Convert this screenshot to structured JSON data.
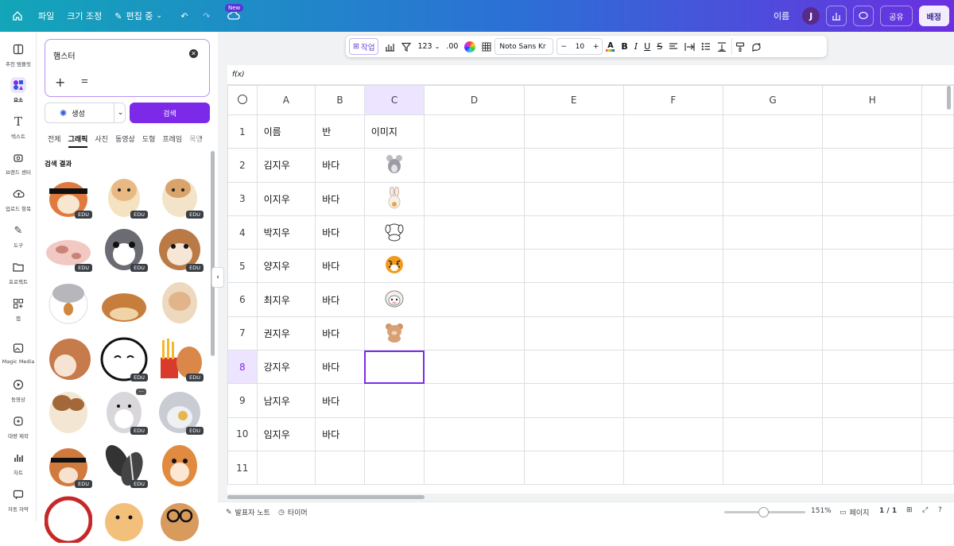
{
  "topbar": {
    "file": "파일",
    "resize": "크기 조정",
    "editing": "편집 중",
    "new_badge": "New",
    "name": "이름",
    "avatar": "J",
    "share": "공유",
    "deploy": "배정"
  },
  "leftnav": {
    "items": [
      {
        "label": "추천 템플릿",
        "icon": "template-icon"
      },
      {
        "label": "요소",
        "icon": "elements-icon"
      },
      {
        "label": "텍스트",
        "icon": "text-icon"
      },
      {
        "label": "브랜드 센터",
        "icon": "brand-icon"
      },
      {
        "label": "업로드 항목",
        "icon": "upload-icon"
      },
      {
        "label": "도구",
        "icon": "draw-icon"
      },
      {
        "label": "프로젝트",
        "icon": "folder-icon"
      },
      {
        "label": "앱",
        "icon": "apps-icon"
      },
      {
        "label": "Magic Media",
        "icon": "magic-media-icon"
      },
      {
        "label": "동영상",
        "icon": "video-icon"
      },
      {
        "label": "대량 제작",
        "icon": "bulk-create-icon"
      },
      {
        "label": "차트",
        "icon": "chart-icon"
      },
      {
        "label": "자동 자막",
        "icon": "captions-icon"
      }
    ]
  },
  "panel": {
    "search_value": "햄스터",
    "generate": "생성",
    "search_button": "검색",
    "tabs": [
      "전체",
      "그래픽",
      "사진",
      "동영상",
      "도형",
      "프레임",
      "목업"
    ],
    "active_tab": "그래픽",
    "section_title": "검색 결과",
    "edu_badge": "EDU"
  },
  "toolbar": {
    "action": "작업",
    "number_format": "123",
    "decimal": ".00",
    "font": "Noto Sans Kr",
    "font_size": "10"
  },
  "sheet": {
    "fx": "f(x)",
    "columns": [
      "A",
      "B",
      "C",
      "D",
      "E",
      "F",
      "G",
      "H"
    ],
    "rows": [
      {
        "n": "1",
        "a": "이름",
        "b": "반",
        "c": "이미지"
      },
      {
        "n": "2",
        "a": "김지우",
        "b": "바다",
        "c": ""
      },
      {
        "n": "3",
        "a": "이지우",
        "b": "바다",
        "c": ""
      },
      {
        "n": "4",
        "a": "박지우",
        "b": "바다",
        "c": ""
      },
      {
        "n": "5",
        "a": "양지우",
        "b": "바다",
        "c": ""
      },
      {
        "n": "6",
        "a": "최지우",
        "b": "바다",
        "c": ""
      },
      {
        "n": "7",
        "a": "권지우",
        "b": "바다",
        "c": ""
      },
      {
        "n": "8",
        "a": "강지우",
        "b": "바다",
        "c": ""
      },
      {
        "n": "9",
        "a": "남지우",
        "b": "바다",
        "c": ""
      },
      {
        "n": "10",
        "a": "임지우",
        "b": "바다",
        "c": ""
      },
      {
        "n": "11",
        "a": "",
        "b": "",
        "c": ""
      }
    ]
  },
  "bottombar": {
    "notes": "발표자 노트",
    "timer": "타이머",
    "zoom": "151%",
    "pages": "페이지",
    "page_count": "1 / 1"
  },
  "colors": {
    "accent": "#7d2ae8",
    "selection_bg": "#ede5ff"
  }
}
